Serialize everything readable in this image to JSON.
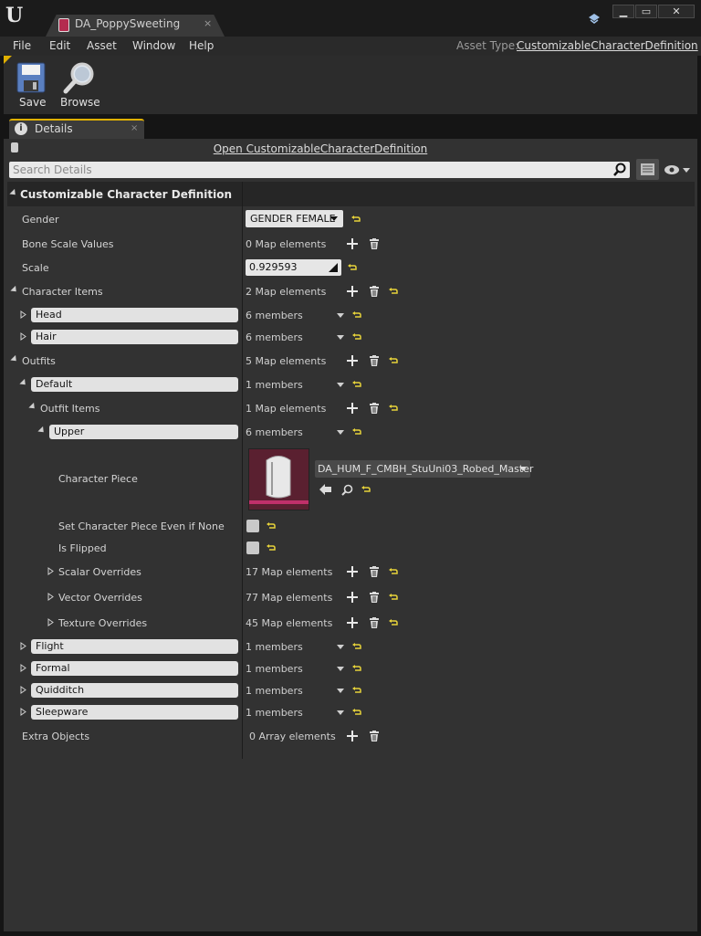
{
  "window": {
    "tab_title": "DA_PoppySweeting",
    "close_glyph": "×",
    "min_glyph": "▁",
    "max_glyph": "▭",
    "close_window_glyph": "✕"
  },
  "menu": {
    "items": [
      "File",
      "Edit",
      "Asset",
      "Window",
      "Help"
    ],
    "asset_type_label": "Asset Type:",
    "asset_type_value": "CustomizableCharacterDefinition"
  },
  "toolbar": {
    "save_label": "Save",
    "browse_label": "Browse"
  },
  "details": {
    "tab_label": "Details",
    "tab_close": "×",
    "info_glyph": "i",
    "open_link": "Open CustomizableCharacterDefinition",
    "search_placeholder": "Search Details",
    "category": "Customizable Character Definition",
    "gender": {
      "label": "Gender",
      "value": "GENDER FEMALE"
    },
    "bone_scale": {
      "label": "Bone Scale Values",
      "value": "0 Map elements"
    },
    "scale": {
      "label": "Scale",
      "value": "0.929593"
    },
    "character_items": {
      "label": "Character Items",
      "value": "2 Map elements"
    },
    "head": {
      "label": "Head",
      "value": "6 members"
    },
    "hair": {
      "label": "Hair",
      "value": "6 members"
    },
    "outfits": {
      "label": "Outfits",
      "value": "5 Map elements"
    },
    "default": {
      "label": "Default",
      "value": "1 members"
    },
    "outfit_items": {
      "label": "Outfit Items",
      "value": "1 Map elements"
    },
    "upper": {
      "label": "Upper",
      "value": "6 members"
    },
    "character_piece": {
      "label": "Character Piece",
      "value": "DA_HUM_F_CMBH_StuUni03_Robed_Master"
    },
    "set_piece_if_none": {
      "label": "Set Character Piece Even if None",
      "checked": false
    },
    "is_flipped": {
      "label": "Is Flipped",
      "checked": false
    },
    "scalar_overrides": {
      "label": "Scalar Overrides",
      "value": "17 Map elements"
    },
    "vector_overrides": {
      "label": "Vector Overrides",
      "value": "77 Map elements"
    },
    "texture_overrides": {
      "label": "Texture Overrides",
      "value": "45 Map elements"
    },
    "flight": {
      "label": "Flight",
      "value": "1 members"
    },
    "formal": {
      "label": "Formal",
      "value": "1 members"
    },
    "quidditch": {
      "label": "Quidditch",
      "value": "1 members"
    },
    "sleepware": {
      "label": "Sleepware",
      "value": "1 members"
    },
    "extra_objects": {
      "label": "Extra Objects",
      "value": "0 Array elements"
    }
  },
  "colors": {
    "accent": "#e0b000",
    "reset_arrow": "#e6d23a",
    "thumbnail_bg": "#5a2030",
    "thumbnail_strip": "#c0306a"
  }
}
